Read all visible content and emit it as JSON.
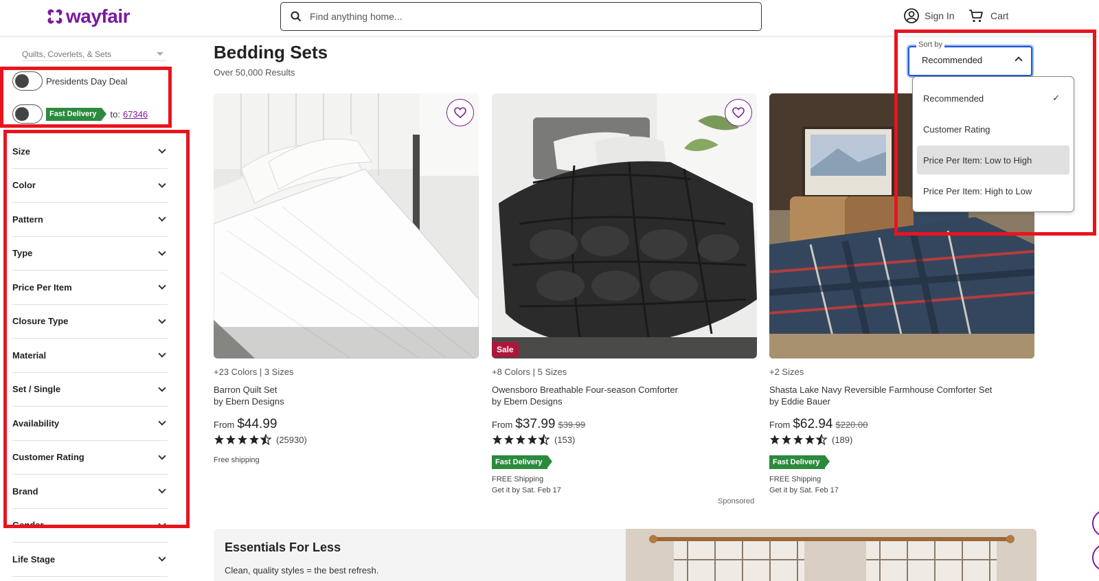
{
  "header": {
    "logo": "wayfair",
    "search_placeholder": "Find anything home...",
    "sign_in": "Sign In",
    "cart": "Cart"
  },
  "sidebar": {
    "breadcrumb": "Quilts, Coverlets, & Sets",
    "presidents_toggle": "Presidents Day Deal",
    "fast_delivery_badge": "Fast Delivery",
    "to_label": "to:",
    "zip": "67346",
    "filters": [
      "Size",
      "Color",
      "Pattern",
      "Type",
      "Price Per Item",
      "Closure Type",
      "Material",
      "Set / Single",
      "Availability",
      "Customer Rating",
      "Brand",
      "Gender",
      "Life Stage"
    ]
  },
  "main": {
    "title": "Bedding Sets",
    "results": "Over 50,000 Results",
    "sponsored": "Sponsored"
  },
  "sort": {
    "label": "Sort by",
    "value": "Recommended",
    "options": [
      "Recommended",
      "Customer Rating",
      "Price Per Item: Low to High",
      "Price Per Item: High to Low"
    ],
    "check": "✓"
  },
  "products": [
    {
      "meta": "+23 Colors | 3 Sizes",
      "name": "Barron Quilt Set",
      "by": "by Ebern Designs",
      "from": "From",
      "price": "$44.99",
      "was": "",
      "rating": 4.5,
      "reviews": "(25930)",
      "note": "Free shipping"
    },
    {
      "meta": "+8 Colors | 5 Sizes",
      "name": "Owensboro Breathable Four-season Comforter",
      "by": "by Ebern Designs",
      "from": "From",
      "price": "$37.99",
      "was": "$39.99",
      "rating": 4.5,
      "reviews": "(153)",
      "badge": "Fast Delivery",
      "ship1": "FREE Shipping",
      "ship2": "Get it by Sat. Feb 17",
      "sale": "Sale"
    },
    {
      "meta": "+2 Sizes",
      "name": "Shasta Lake Navy Reversible Farmhouse Comforter Set",
      "by": "by Eddie Bauer",
      "from": "From",
      "price": "$62.94",
      "was": "$220.00",
      "rating": 4.5,
      "reviews": "(189)",
      "badge": "Fast Delivery",
      "ship1": "FREE Shipping",
      "ship2": "Get it by Sat. Feb 17"
    }
  ],
  "essentials": {
    "title": "Essentials For Less",
    "subtitle": "Clean, quality styles = the best refresh."
  },
  "colors": {
    "brand": "#7b189f",
    "annotation": "#e8141e",
    "fast_delivery": "#2b8a3e",
    "sale": "#b0153a",
    "focus": "#1d5ad6"
  }
}
